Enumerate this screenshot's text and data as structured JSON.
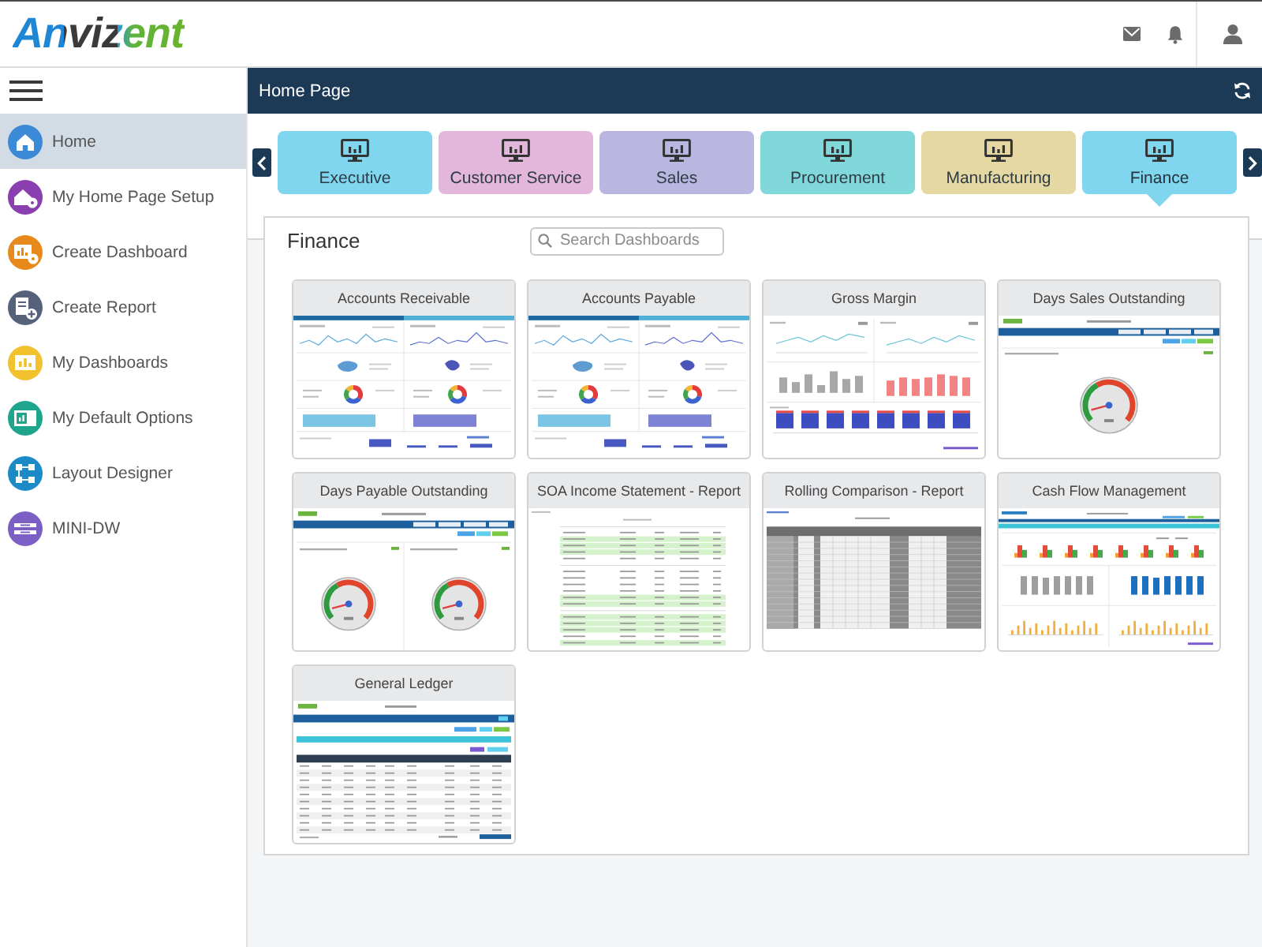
{
  "header": {
    "logo": "Anvizent"
  },
  "sidebar": {
    "items": [
      {
        "label": "Home",
        "selected": true,
        "color": "#3b8ad8"
      },
      {
        "label": "My Home Page Setup",
        "selected": false,
        "color": "#8a3fb0"
      },
      {
        "label": "Create Dashboard",
        "selected": false,
        "color": "#e8891c"
      },
      {
        "label": "Create Report",
        "selected": false,
        "color": "#56627a"
      },
      {
        "label": "My Dashboards",
        "selected": false,
        "color": "#f2c12e"
      },
      {
        "label": "My Default Options",
        "selected": false,
        "color": "#1ea58e"
      },
      {
        "label": "Layout Designer",
        "selected": false,
        "color": "#1b8bc8"
      },
      {
        "label": "MINI-DW",
        "selected": false,
        "color": "#7b5fc4"
      }
    ]
  },
  "page": {
    "title": "Home Page"
  },
  "tabs": [
    {
      "label": "Executive",
      "selected": false,
      "color": "#7fd6ee"
    },
    {
      "label": "Customer Service",
      "selected": false,
      "color": "#e3b6dc"
    },
    {
      "label": "Sales",
      "selected": false,
      "color": "#b9b7e0"
    },
    {
      "label": "Procurement",
      "selected": false,
      "color": "#80d8da"
    },
    {
      "label": "Manufacturing",
      "selected": false,
      "color": "#e6d8a2"
    },
    {
      "label": "Finance",
      "selected": true,
      "color": "#7fd6ee"
    }
  ],
  "panel": {
    "title": "Finance",
    "search": {
      "placeholder": "Search Dashboards"
    },
    "cards": [
      {
        "title": "Accounts Receivable",
        "kind": "trend-grid"
      },
      {
        "title": "Accounts Payable",
        "kind": "trend-grid"
      },
      {
        "title": "Gross Margin",
        "kind": "margin-charts"
      },
      {
        "title": "Days Sales Outstanding",
        "kind": "gauge"
      },
      {
        "title": "Days Payable Outstanding",
        "kind": "gauge-pair"
      },
      {
        "title": "SOA Income Statement - Report",
        "kind": "statement"
      },
      {
        "title": "Rolling Comparison - Report",
        "kind": "grey-table"
      },
      {
        "title": "Cash Flow Management",
        "kind": "cashflow"
      },
      {
        "title": "General Ledger",
        "kind": "ledger"
      }
    ]
  }
}
